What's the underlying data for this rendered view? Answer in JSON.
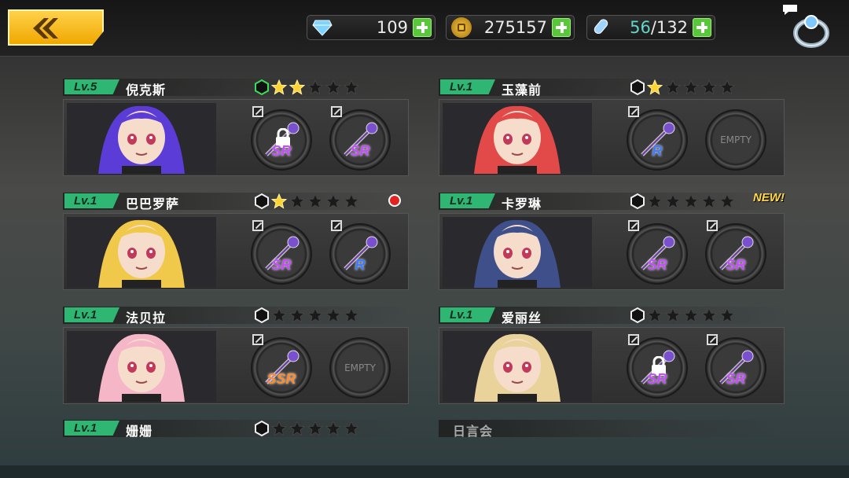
{
  "header": {
    "back_icon": "back-arrow-icon",
    "resources": [
      {
        "icon": "gem-icon",
        "value": "109"
      },
      {
        "icon": "gold-coin-icon",
        "value": "275157"
      },
      {
        "icon": "energy-capsule-icon",
        "current": "56",
        "max": "/132"
      }
    ],
    "ring_icon": "ring-icon",
    "chat_icon": "speech-bubble-icon"
  },
  "characters": [
    {
      "level": "Lv.5",
      "name": "倪克斯",
      "stars": 2,
      "hex_green": true,
      "new": "",
      "notification": false,
      "slots": [
        {
          "rarity": "SR",
          "locked": true,
          "empty": false
        },
        {
          "rarity": "SR",
          "locked": false,
          "empty": false
        }
      ],
      "colors": {
        "hair": "#5b3cd6"
      }
    },
    {
      "level": "Lv.1",
      "name": "玉藻前",
      "stars": 1,
      "hex_green": false,
      "new": "",
      "notification": false,
      "slots": [
        {
          "rarity": "R",
          "locked": false,
          "empty": false
        },
        {
          "rarity": "",
          "locked": false,
          "empty": true,
          "empty_label": "EMPTY"
        }
      ],
      "colors": {
        "hair": "#e24a4a"
      }
    },
    {
      "level": "Lv.1",
      "name": "巴巴罗萨",
      "stars": 1,
      "hex_green": false,
      "new": "",
      "notification": true,
      "slots": [
        {
          "rarity": "SR",
          "locked": false,
          "empty": false
        },
        {
          "rarity": "R",
          "locked": false,
          "empty": false
        }
      ],
      "colors": {
        "hair": "#f0c94a"
      }
    },
    {
      "level": "Lv.1",
      "name": "卡罗琳",
      "stars": 0,
      "hex_green": false,
      "new": "NEW!",
      "notification": false,
      "slots": [
        {
          "rarity": "SR",
          "locked": false,
          "empty": false
        },
        {
          "rarity": "SR",
          "locked": false,
          "empty": false
        }
      ],
      "colors": {
        "hair": "#3f4f8a"
      }
    },
    {
      "level": "Lv.1",
      "name": "法贝拉",
      "stars": 0,
      "hex_green": false,
      "new": "",
      "notification": false,
      "slots": [
        {
          "rarity": "SSR",
          "locked": false,
          "empty": false
        },
        {
          "rarity": "",
          "locked": false,
          "empty": true,
          "empty_label": "EMPTY"
        }
      ],
      "colors": {
        "hair": "#f5b6c8"
      }
    },
    {
      "level": "Lv.1",
      "name": "爱丽丝",
      "stars": 0,
      "hex_green": false,
      "new": "",
      "notification": false,
      "slots": [
        {
          "rarity": "SR",
          "locked": true,
          "empty": false
        },
        {
          "rarity": "SR",
          "locked": false,
          "empty": false
        }
      ],
      "colors": {
        "hair": "#e9d39a"
      }
    },
    {
      "level": "Lv.1",
      "name": "姗姗",
      "stars": 0,
      "partial": true
    },
    {
      "level": "",
      "name": "日言会",
      "stars": 0,
      "partial": true
    }
  ]
}
